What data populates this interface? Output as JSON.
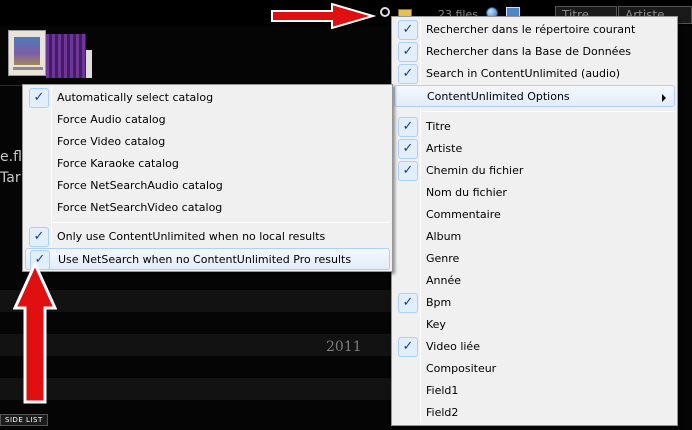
{
  "topbar": {
    "file_count": "23 files",
    "column_title": "Titre",
    "column_artist": "Artiste"
  },
  "list": {
    "fragment_1": "e.flv",
    "fragment_2": "Tar",
    "year": "2011",
    "side_list_label": "SIDE LIST"
  },
  "catalog_menu": {
    "items": [
      {
        "label": "Automatically select catalog",
        "checked": true
      },
      {
        "label": "Force Audio catalog",
        "checked": false
      },
      {
        "label": "Force Video catalog",
        "checked": false
      },
      {
        "label": "Force Karaoke catalog",
        "checked": false
      },
      {
        "label": "Force NetSearchAudio catalog",
        "checked": false
      },
      {
        "label": "Force NetSearchVideo catalog",
        "checked": false
      },
      {
        "label": "Only use ContentUnlimited when no local results",
        "checked": true
      },
      {
        "label": "Use NetSearch when no ContentUnlimited Pro results",
        "checked": true,
        "highlighted": true
      }
    ]
  },
  "search_menu": {
    "items": [
      {
        "label": "Rechercher dans le répertoire courant",
        "checked": true
      },
      {
        "label": "Rechercher dans la Base de Données",
        "checked": true
      },
      {
        "label": "Search in ContentUnlimited (audio)",
        "checked": true
      },
      {
        "label": "ContentUnlimited Options",
        "checked": false,
        "submenu": true,
        "highlighted": true
      },
      {
        "label": "Titre",
        "checked": true
      },
      {
        "label": "Artiste",
        "checked": true
      },
      {
        "label": "Chemin du fichier",
        "checked": true
      },
      {
        "label": "Nom du fichier",
        "checked": false
      },
      {
        "label": "Commentaire",
        "checked": false
      },
      {
        "label": "Album",
        "checked": false
      },
      {
        "label": "Genre",
        "checked": false
      },
      {
        "label": "Année",
        "checked": false
      },
      {
        "label": "Bpm",
        "checked": true
      },
      {
        "label": "Key",
        "checked": false
      },
      {
        "label": "Video liée",
        "checked": true
      },
      {
        "label": "Compositeur",
        "checked": false
      },
      {
        "label": "Field1",
        "checked": false
      },
      {
        "label": "Field2",
        "checked": false
      }
    ]
  },
  "icons": {
    "check": "check-icon",
    "search": "search-icon",
    "folder": "folder-icon",
    "globe": "globe-icon",
    "monitor": "monitor-icon",
    "arrow": "red-arrow-icon"
  },
  "colors": {
    "arrow_red": "#e01010",
    "check_blue": "#1b3d8f",
    "menu_bg": "#f0f0f0"
  }
}
